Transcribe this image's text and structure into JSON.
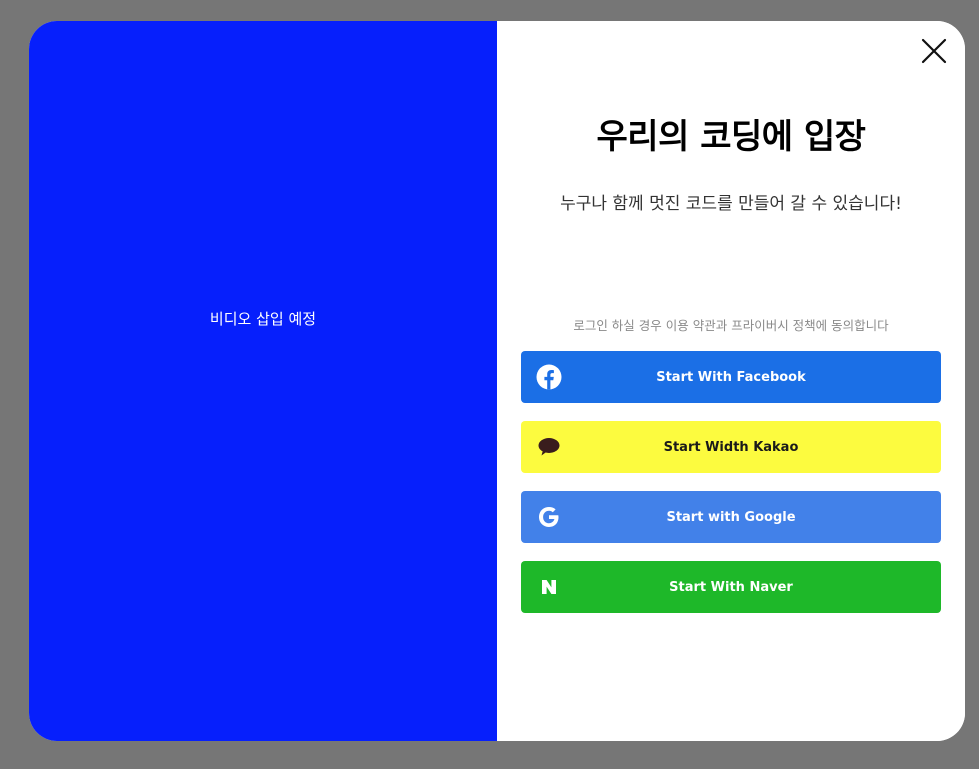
{
  "video": {
    "placeholder": "비디오 삽입 예정"
  },
  "login": {
    "title": "우리의 코딩에 입장",
    "subtitle": "누구나 함께 멋진 코드를 만들어 갈 수 있습니다!",
    "terms": "로그인 하실 경우 이용 약관과 프라이버시 정책에 동의합니다",
    "buttons": {
      "facebook": "Start With Facebook",
      "kakao": "Start Width Kakao",
      "google": "Start with Google",
      "naver": "Start With Naver"
    }
  },
  "colors": {
    "video_bg": "#061ffc",
    "facebook": "#1b6fe6",
    "kakao": "#fcfb3f",
    "google": "#4281e9",
    "naver": "#1eb829"
  },
  "icons": {
    "close": "close-icon",
    "facebook": "facebook-icon",
    "kakao": "kakao-chat-icon",
    "google": "google-icon",
    "naver": "naver-icon"
  }
}
